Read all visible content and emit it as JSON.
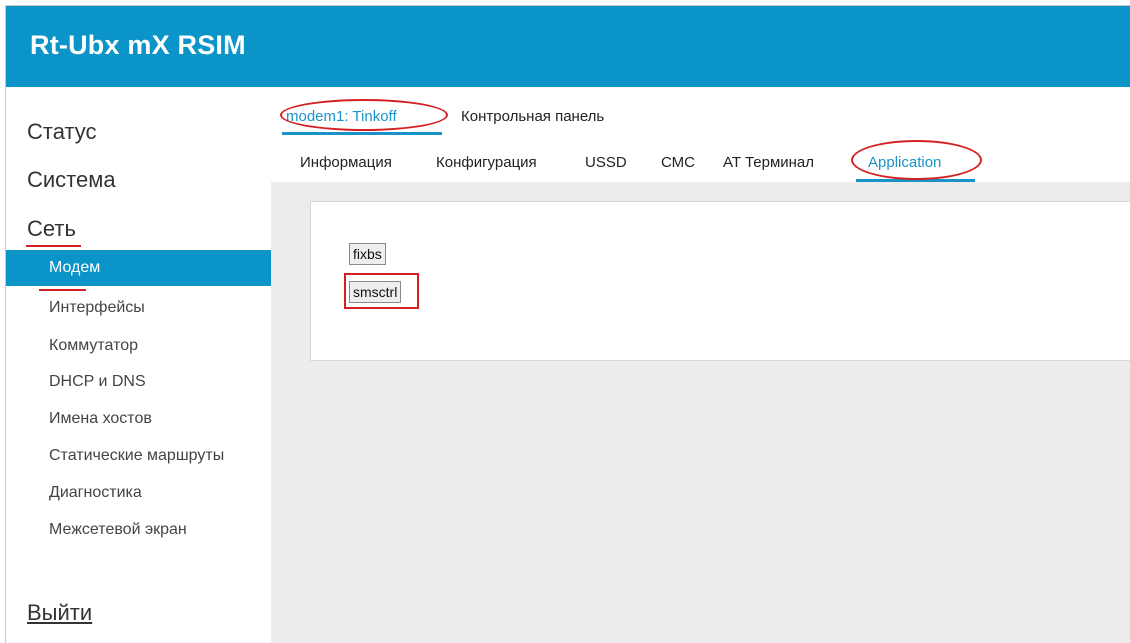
{
  "header": {
    "title": "Rt-Ubx mX RSIM"
  },
  "sidebar": {
    "status": "Статус",
    "system": "Система",
    "network": "Сеть",
    "items": [
      "Модем",
      "Интерфейсы",
      "Коммутатор",
      "DHCP и DNS",
      "Имена хостов",
      "Статические маршруты",
      "Диагностика",
      "Межсетевой экран"
    ],
    "active_item": "Модем",
    "logout": "Выйти"
  },
  "top_tabs": [
    "modem1: Tinkoff",
    "Контрольная панель"
  ],
  "sub_tabs": [
    "Информация",
    "Конфигурация",
    "USSD",
    "СМС",
    "AT Терминал",
    "Application"
  ],
  "active_top_tab": "modem1: Tinkoff",
  "active_sub_tab": "Application",
  "panel": {
    "buttons": [
      "fixbs",
      "smsctrl"
    ]
  },
  "colors": {
    "accent": "#0a94c8",
    "highlight": "#d42020",
    "background": "#ececec"
  }
}
